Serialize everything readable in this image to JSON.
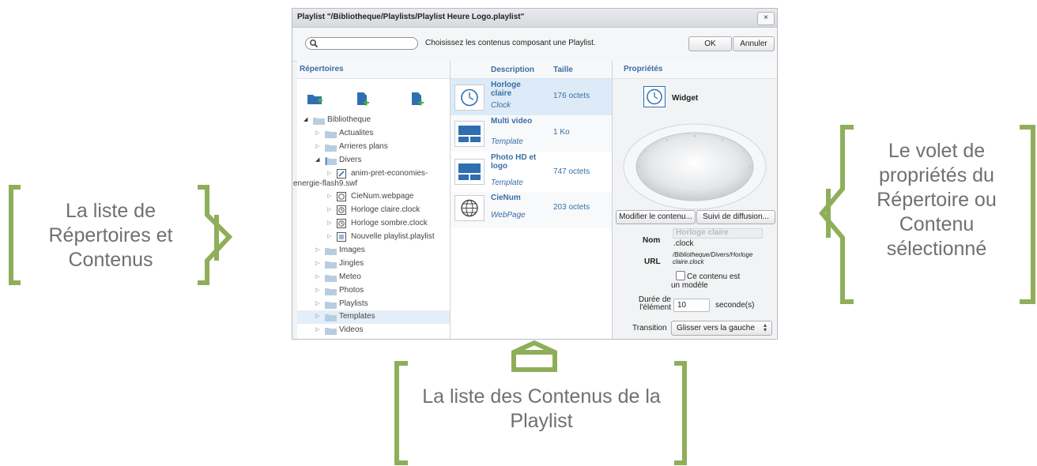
{
  "dialog": {
    "title": "Playlist \"/Bibliotheque/Playlists/Playlist Heure Logo.playlist\"",
    "close_label": "×",
    "search_placeholder": "",
    "hint": "Choisissez les contenus composant une Playlist.",
    "ok_label": "OK",
    "cancel_label": "Annuler"
  },
  "directories": {
    "header": "Répertoires",
    "toolbar_icons": [
      "add-folder-icon",
      "add-file-icon",
      "add-file-icon"
    ],
    "items": [
      {
        "label": "Bibliotheque",
        "level": 0,
        "expanded": true,
        "icon": "folder-icon"
      },
      {
        "label": "Actualites",
        "level": 1,
        "expanded": false,
        "icon": "folder-icon"
      },
      {
        "label": "Arrieres plans",
        "level": 1,
        "expanded": false,
        "icon": "folder-icon"
      },
      {
        "label": "Divers",
        "level": 1,
        "expanded": true,
        "icon": "folder-icon"
      },
      {
        "label": "anim-pret-economies-",
        "label2": "energie-flash9.swf",
        "level": 2,
        "icon": "flash-file-icon"
      },
      {
        "label": "CieNum.webpage",
        "level": 2,
        "icon": "webpage-icon"
      },
      {
        "label": "Horloge claire.clock",
        "level": 2,
        "icon": "clock-icon"
      },
      {
        "label": "Horloge sombre.clock",
        "level": 2,
        "icon": "clock-icon"
      },
      {
        "label": "Nouvelle playlist.playlist",
        "level": 2,
        "icon": "playlist-icon"
      },
      {
        "label": "Images",
        "level": 1,
        "icon": "folder-icon"
      },
      {
        "label": "Jingles",
        "level": 1,
        "icon": "folder-icon"
      },
      {
        "label": "Meteo",
        "level": 1,
        "icon": "folder-icon"
      },
      {
        "label": "Photos",
        "level": 1,
        "icon": "folder-icon"
      },
      {
        "label": "Playlists",
        "level": 1,
        "icon": "folder-icon"
      },
      {
        "label": "Templates",
        "level": 1,
        "icon": "folder-icon",
        "selected": true
      },
      {
        "label": "Videos",
        "level": 1,
        "icon": "folder-icon"
      }
    ]
  },
  "playlist": {
    "col_description": "Description",
    "col_size": "Taille",
    "items": [
      {
        "description": "Horloge claire",
        "type": "Clock",
        "size": "176 octets",
        "icon": "clock-icon",
        "selected": true
      },
      {
        "description": "Multi video",
        "type": "Template",
        "size": "1 Ko",
        "icon": "template-icon"
      },
      {
        "description": "Photo HD et logo",
        "type": "Template",
        "size": "747 octets",
        "icon": "template-icon"
      },
      {
        "description": "CieNum",
        "type": "WebPage",
        "size": "203 octets",
        "icon": "globe-icon"
      }
    ]
  },
  "properties": {
    "header": "Propriétés",
    "widget_label": "Widget",
    "modify_button": "Modifier le contenu...",
    "tracking_button": "Suivi de diffusion...",
    "name_label": "Nom",
    "name_value": "Horloge claire",
    "name_ext": ".clock",
    "url_label": "URL",
    "url_value": "/Bibliotheque/Divers/Horloge claire.clock",
    "model_checkbox": "Ce contenu est un modèle",
    "duration_label": "Durée de l'élément",
    "duration_value": "10",
    "duration_unit": "seconde(s)",
    "transition_label": "Transition",
    "transition_value": "Glisser vers la gauche"
  },
  "annotations": {
    "left": "La liste de Répertoires et Contenus",
    "right": "Le volet de propriétés du Répertoire ou Contenu sélectionné",
    "bottom": "La liste des Contenus de la Playlist",
    "color": "#8fae5a"
  }
}
